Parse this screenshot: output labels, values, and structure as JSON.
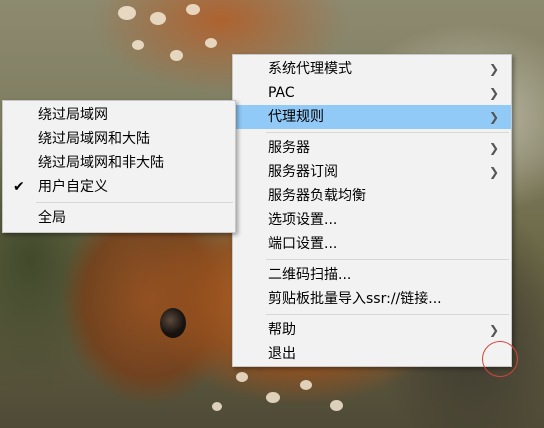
{
  "main_menu": {
    "items": [
      {
        "label": "系统代理模式"
      },
      {
        "label": "PAC"
      },
      {
        "label": "代理规则"
      },
      {
        "label": "服务器"
      },
      {
        "label": "服务器订阅"
      },
      {
        "label": "服务器负载均衡"
      },
      {
        "label": "选项设置..."
      },
      {
        "label": "端口设置..."
      },
      {
        "label": "二维码扫描..."
      },
      {
        "label": "剪贴板批量导入ssr://链接..."
      },
      {
        "label": "帮助"
      },
      {
        "label": "退出"
      }
    ]
  },
  "proxy_rules_submenu": {
    "items": [
      {
        "label": "绕过局域网"
      },
      {
        "label": "绕过局域网和大陆"
      },
      {
        "label": "绕过局域网和非大陆"
      },
      {
        "label": "用户自定义"
      },
      {
        "label": "全局"
      }
    ]
  },
  "icons": {
    "submenu_arrow": "chevron-right-icon",
    "selected_mark": "checkmark-icon"
  },
  "colors": {
    "highlight": "#91c9f7",
    "menu_bg": "#f2f2f2",
    "cursor_ring": "#d6433b"
  }
}
